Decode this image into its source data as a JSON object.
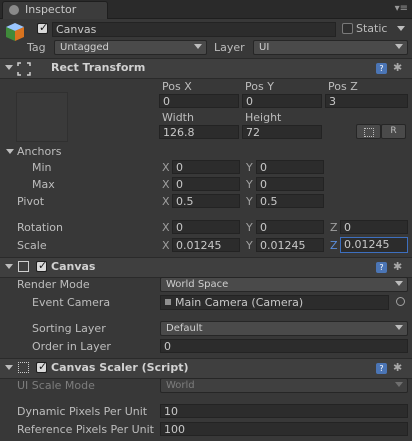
{
  "tab": {
    "label": "Inspector"
  },
  "object": {
    "name": "Canvas",
    "static_label": "Static",
    "tag_label": "Tag",
    "tag_value": "Untagged",
    "layer_label": "Layer",
    "layer_value": "UI"
  },
  "rect_transform": {
    "title": "Rect Transform",
    "headers": [
      "Pos X",
      "Pos Y",
      "Pos Z"
    ],
    "pos": [
      "0",
      "0",
      "3"
    ],
    "size_headers": [
      "Width",
      "Height"
    ],
    "size": [
      "126.8",
      "72"
    ],
    "raw_button": "R",
    "anchors_label": "Anchors",
    "min_label": "Min",
    "min": [
      "0",
      "0"
    ],
    "max_label": "Max",
    "max": [
      "0",
      "0"
    ],
    "pivot_label": "Pivot",
    "pivot": [
      "0.5",
      "0.5"
    ],
    "rotation_label": "Rotation",
    "rotation": [
      "0",
      "0",
      "0"
    ],
    "scale_label": "Scale",
    "scale": [
      "0.01245",
      "0.01245",
      "0.01245"
    ],
    "axes": [
      "X",
      "Y",
      "Z"
    ]
  },
  "canvas": {
    "title": "Canvas",
    "render_mode_label": "Render Mode",
    "render_mode_value": "World Space",
    "event_camera_label": "Event Camera",
    "event_camera_value": "Main Camera (Camera)",
    "sorting_layer_label": "Sorting Layer",
    "sorting_layer_value": "Default",
    "order_label": "Order in Layer",
    "order_value": "0"
  },
  "canvas_scaler": {
    "title": "Canvas Scaler (Script)",
    "ui_scale_mode_label": "UI Scale Mode",
    "ui_scale_mode_value": "World",
    "dynamic_label": "Dynamic Pixels Per Unit",
    "dynamic_value": "10",
    "reference_label": "Reference Pixels Per Unit",
    "reference_value": "100"
  },
  "colors": {
    "background": "#383838",
    "header": "#3f3f3f",
    "focus": "#3d6fbf",
    "help_icon": "#4b75b5"
  },
  "icons": [
    "inspector-icon",
    "gameobject-cube-icon",
    "rect-transform-icon",
    "canvas-icon",
    "script-icon",
    "help-book-icon",
    "gear-icon",
    "blueprint-icon",
    "object-picker-icon"
  ]
}
